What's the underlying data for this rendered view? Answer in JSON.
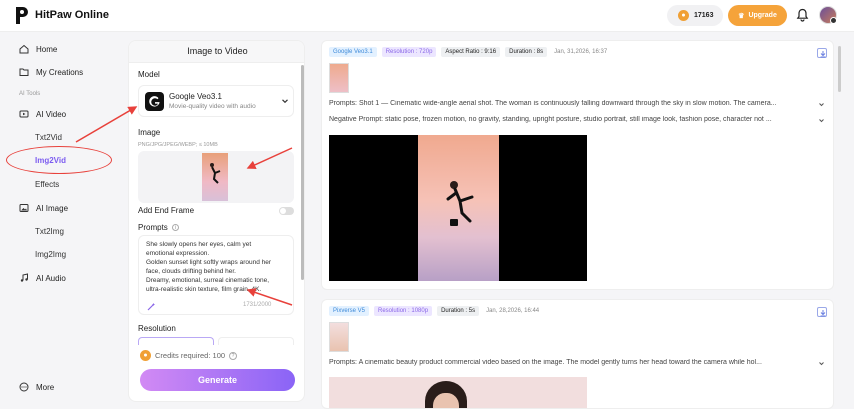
{
  "header": {
    "brand": "HitPaw Online",
    "credits": "17163",
    "upgrade_label": "Upgrade"
  },
  "sidebar": {
    "home": "Home",
    "my_creations": "My Creations",
    "section": "AI Tools",
    "ai_video": "AI Video",
    "txt2vid": "Txt2Vid",
    "img2vid": "Img2Vid",
    "effects": "Effects",
    "ai_image": "AI Image",
    "txt2img": "Txt2Img",
    "img2img": "Img2Img",
    "ai_audio": "AI Audio",
    "more": "More"
  },
  "panel": {
    "title": "Image to Video",
    "model_label": "Model",
    "model_name": "Google Veo3.1",
    "model_desc": "Movie-quality video with audio",
    "image_label": "Image",
    "image_hint": "PNG/JPG/JPEG/WEBP; ≤ 10MB",
    "end_frame_label": "Add End Frame",
    "prompts_label": "Prompts",
    "prompt_text": "She slowly opens her eyes, calm yet\nemotional expression.\nGolden sunset light softly wraps around her\nface, clouds drifting behind her.\nDreamy, emotional, surreal cinematic tone,\nultra-realistic skin texture, film grain, 4K.",
    "prompt_count": "1731/2000",
    "resolution_label": "Resolution",
    "credits_text": "Credits required: 100",
    "generate_label": "Generate"
  },
  "cards": [
    {
      "tags": [
        "Google Veo3.1",
        "Resolution : 720p",
        "Aspect Ratio : 9:16",
        "Duration : 8s"
      ],
      "date": "Jan, 31,2026, 16:37",
      "prompt": "Prompts: Shot 1 — Cinematic wide-angle aerial shot. The woman is continuously falling downward through the sky in slow motion. The camera...",
      "negative": "Negative Prompt: static pose, frozen motion, no gravity, standing, upright posture, studio portrait, still image look, fashion pose, character not ..."
    },
    {
      "tags": [
        "Pixverse V5",
        "Resolution : 1080p",
        "Duration : 5s"
      ],
      "date": "Jan, 28,2026, 16:44",
      "prompt": "Prompts: A cinematic beauty product commercial video based on the image. The model gently turns her head toward the camera while hol..."
    }
  ],
  "colors": {
    "accent": "#7c5cf0",
    "upgrade": "#f5a33a",
    "annotation_red": "#e8413b"
  }
}
